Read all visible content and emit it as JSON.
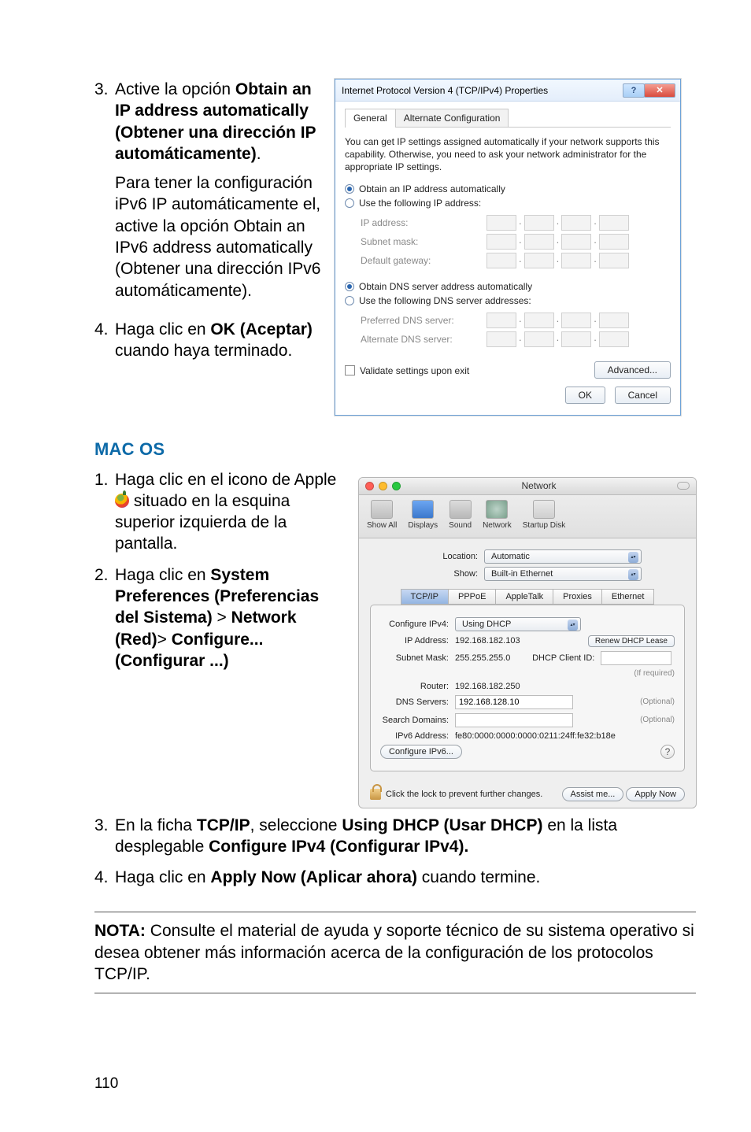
{
  "steps_top": [
    {
      "num": "3.",
      "text_before": "Active la opción ",
      "bold": "Obtain an IP address automatically (Obtener una dirección IP automáticamente)",
      "text_after": ".",
      "para2": "Para tener la configuración iPv6 IP automáticamente el, active la opción Obtain an IPv6 address automatically (Obtener una dirección IPv6 automáticamente)."
    },
    {
      "num": "4.",
      "text_before": "Haga clic en ",
      "bold": "OK (Aceptar)",
      "text_after": " cuando haya terminado."
    }
  ],
  "win": {
    "title": "Internet Protocol Version 4 (TCP/IPv4) Properties",
    "tab_general": "General",
    "tab_alt": "Alternate Configuration",
    "desc": "You can get IP settings assigned automatically if your network supports this capability. Otherwise, you need to ask your network administrator for the appropriate IP settings.",
    "r_obtain_ip": "Obtain an IP address automatically",
    "r_use_ip": "Use the following IP address:",
    "l_ip": "IP address:",
    "l_mask": "Subnet mask:",
    "l_gw": "Default gateway:",
    "r_obtain_dns": "Obtain DNS server address automatically",
    "r_use_dns": "Use the following DNS server addresses:",
    "l_pref_dns": "Preferred DNS server:",
    "l_alt_dns": "Alternate DNS server:",
    "validate": "Validate settings upon exit",
    "advanced": "Advanced...",
    "ok": "OK",
    "cancel": "Cancel",
    "help": "?",
    "close": "✕"
  },
  "macos_head": "MAC OS",
  "steps_mac": [
    {
      "num": "1.",
      "pre": "Haga clic en el icono de Apple ",
      "post": " situado en la esquina superior izquierda de la pantalla."
    },
    {
      "num": "2.",
      "pre": "Haga clic en ",
      "b1": "System Preferences (Preferencias del Sistema)",
      "mid": " > ",
      "b2": "Network (Red)",
      "mid2": "> ",
      "b3": "Configure... (Configurar ...)"
    }
  ],
  "steps_mac_bottom": [
    {
      "num": "3.",
      "pre": "En la ficha ",
      "b1": "TCP/IP",
      "mid": ", seleccione ",
      "b2": "Using DHCP (Usar DHCP)",
      "post": " en la lista desplegable ",
      "b3": "Configure IPv4 (Configurar IPv4)."
    },
    {
      "num": "4.",
      "pre": "Haga clic en ",
      "b1": "Apply Now (Aplicar ahora)",
      "post": " cuando termine."
    }
  ],
  "mac": {
    "title": "Network",
    "tool": {
      "showall": "Show All",
      "disp": "Displays",
      "sound": "Sound",
      "net": "Network",
      "start": "Startup Disk"
    },
    "location_l": "Location:",
    "location_v": "Automatic",
    "show_l": "Show:",
    "show_v": "Built-in Ethernet",
    "tabs": {
      "tcpip": "TCP/IP",
      "pppoe": "PPPoE",
      "appletalk": "AppleTalk",
      "proxies": "Proxies",
      "ethernet": "Ethernet"
    },
    "conf_l": "Configure IPv4:",
    "conf_v": "Using DHCP",
    "ip_l": "IP Address:",
    "ip_v": "192.168.182.103",
    "renew": "Renew DHCP Lease",
    "mask_l": "Subnet Mask:",
    "mask_v": "255.255.255.0",
    "client_l": "DHCP Client ID:",
    "client_hint": "(If required)",
    "router_l": "Router:",
    "router_v": "192.168.182.250",
    "dns_l": "DNS Servers:",
    "dns_v": "192.168.128.10",
    "opt": "(Optional)",
    "search_l": "Search Domains:",
    "ipv6_l": "IPv6 Address:",
    "ipv6_v": "fe80:0000:0000:0000:0211:24ff:fe32:b18e",
    "conf6": "Configure IPv6...",
    "lock": "Click the lock to prevent further changes.",
    "assist": "Assist me...",
    "apply": "Apply Now"
  },
  "note_label": "NOTA:",
  "note_body": "Consulte el material de ayuda y soporte técnico de su sistema operativo si desea obtener más información acerca de la configuración de los protocolos TCP/IP.",
  "page_num": "110"
}
